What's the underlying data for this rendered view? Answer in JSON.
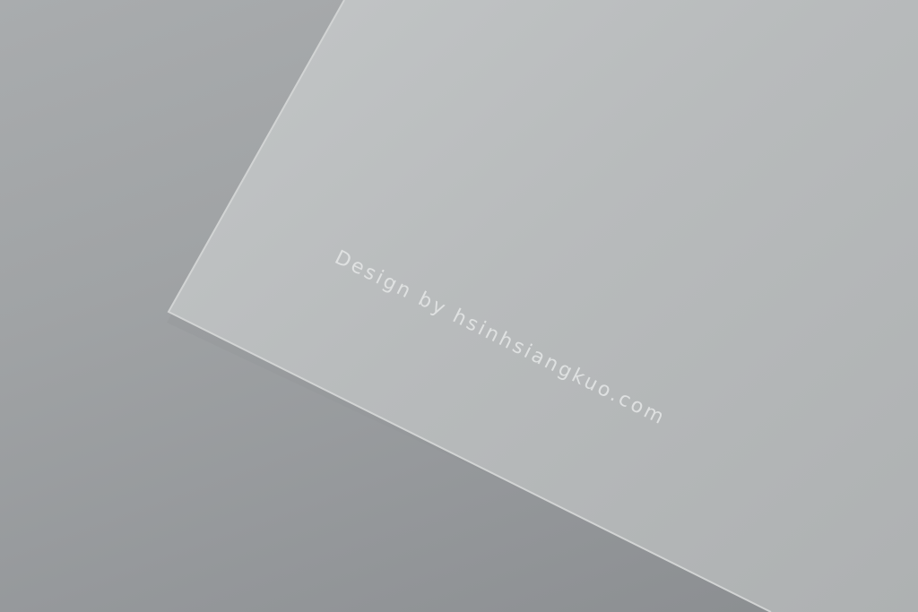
{
  "photo": {
    "watermark_text": "Design by hsinhsiangkuo.com",
    "colors": {
      "background": "#9a9d9f",
      "paper": "#b9bcbd",
      "paper_edge": "#d2d4d4",
      "text": "#e6e8e8"
    }
  }
}
